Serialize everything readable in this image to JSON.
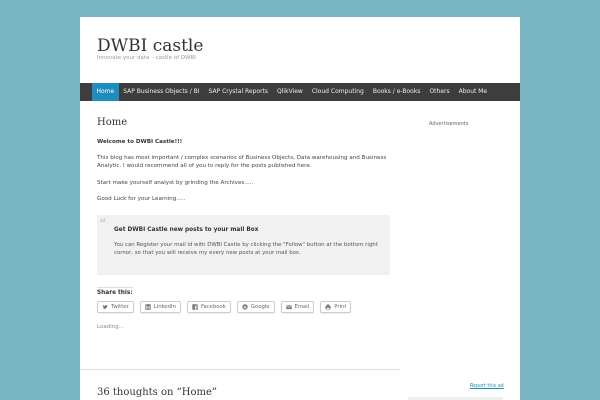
{
  "site": {
    "title": "DWBI castle",
    "description": "Innovate your data – castle of DWBI"
  },
  "nav": {
    "items": [
      {
        "label": "Home",
        "active": true
      },
      {
        "label": "SAP Business Objects / BI"
      },
      {
        "label": "SAP Crystal Reports"
      },
      {
        "label": "QlikView"
      },
      {
        "label": "Cloud Computing"
      },
      {
        "label": "Books / e-Books"
      },
      {
        "label": "Others"
      },
      {
        "label": "About Me"
      }
    ]
  },
  "entry": {
    "title": "Home",
    "welcome": "Welcome to DWBI Castle!!!",
    "paragraph1": "This blog has most important / complex scenarios of Business Objects, Data warehousing and Business Analytic. I would recommend all of you to reply for the posts published here.",
    "paragraph2": "Start make yourself analyst by grinding the Archives.....",
    "paragraph3": "Good Luck for your Learning.....",
    "quote": {
      "mark": "“",
      "title": "Get DWBI Castle new posts to your mail Box",
      "text": "You can Register your mail id with DWBI Castle by clicking the \"Follow\" button at the bottom right cornor, so that you will receive my every new posts at your mail box."
    }
  },
  "share": {
    "title": "Share this:",
    "buttons": [
      {
        "label": "Twitter",
        "icon": "twitter-icon"
      },
      {
        "label": "LinkedIn",
        "icon": "linkedin-icon"
      },
      {
        "label": "Facebook",
        "icon": "facebook-icon"
      },
      {
        "label": "Google",
        "icon": "google-icon"
      },
      {
        "label": "Email",
        "icon": "email-icon"
      },
      {
        "label": "Print",
        "icon": "print-icon"
      }
    ],
    "loading": "Loading..."
  },
  "comments": {
    "title": "36 thoughts on “Home”"
  },
  "sidebar": {
    "ad_label": "Advertisements",
    "report_ad": "Report this ad"
  },
  "colors": {
    "background": "#7ab5c2",
    "nav_bg": "#3d3d3d",
    "accent": "#1e8cbe"
  }
}
